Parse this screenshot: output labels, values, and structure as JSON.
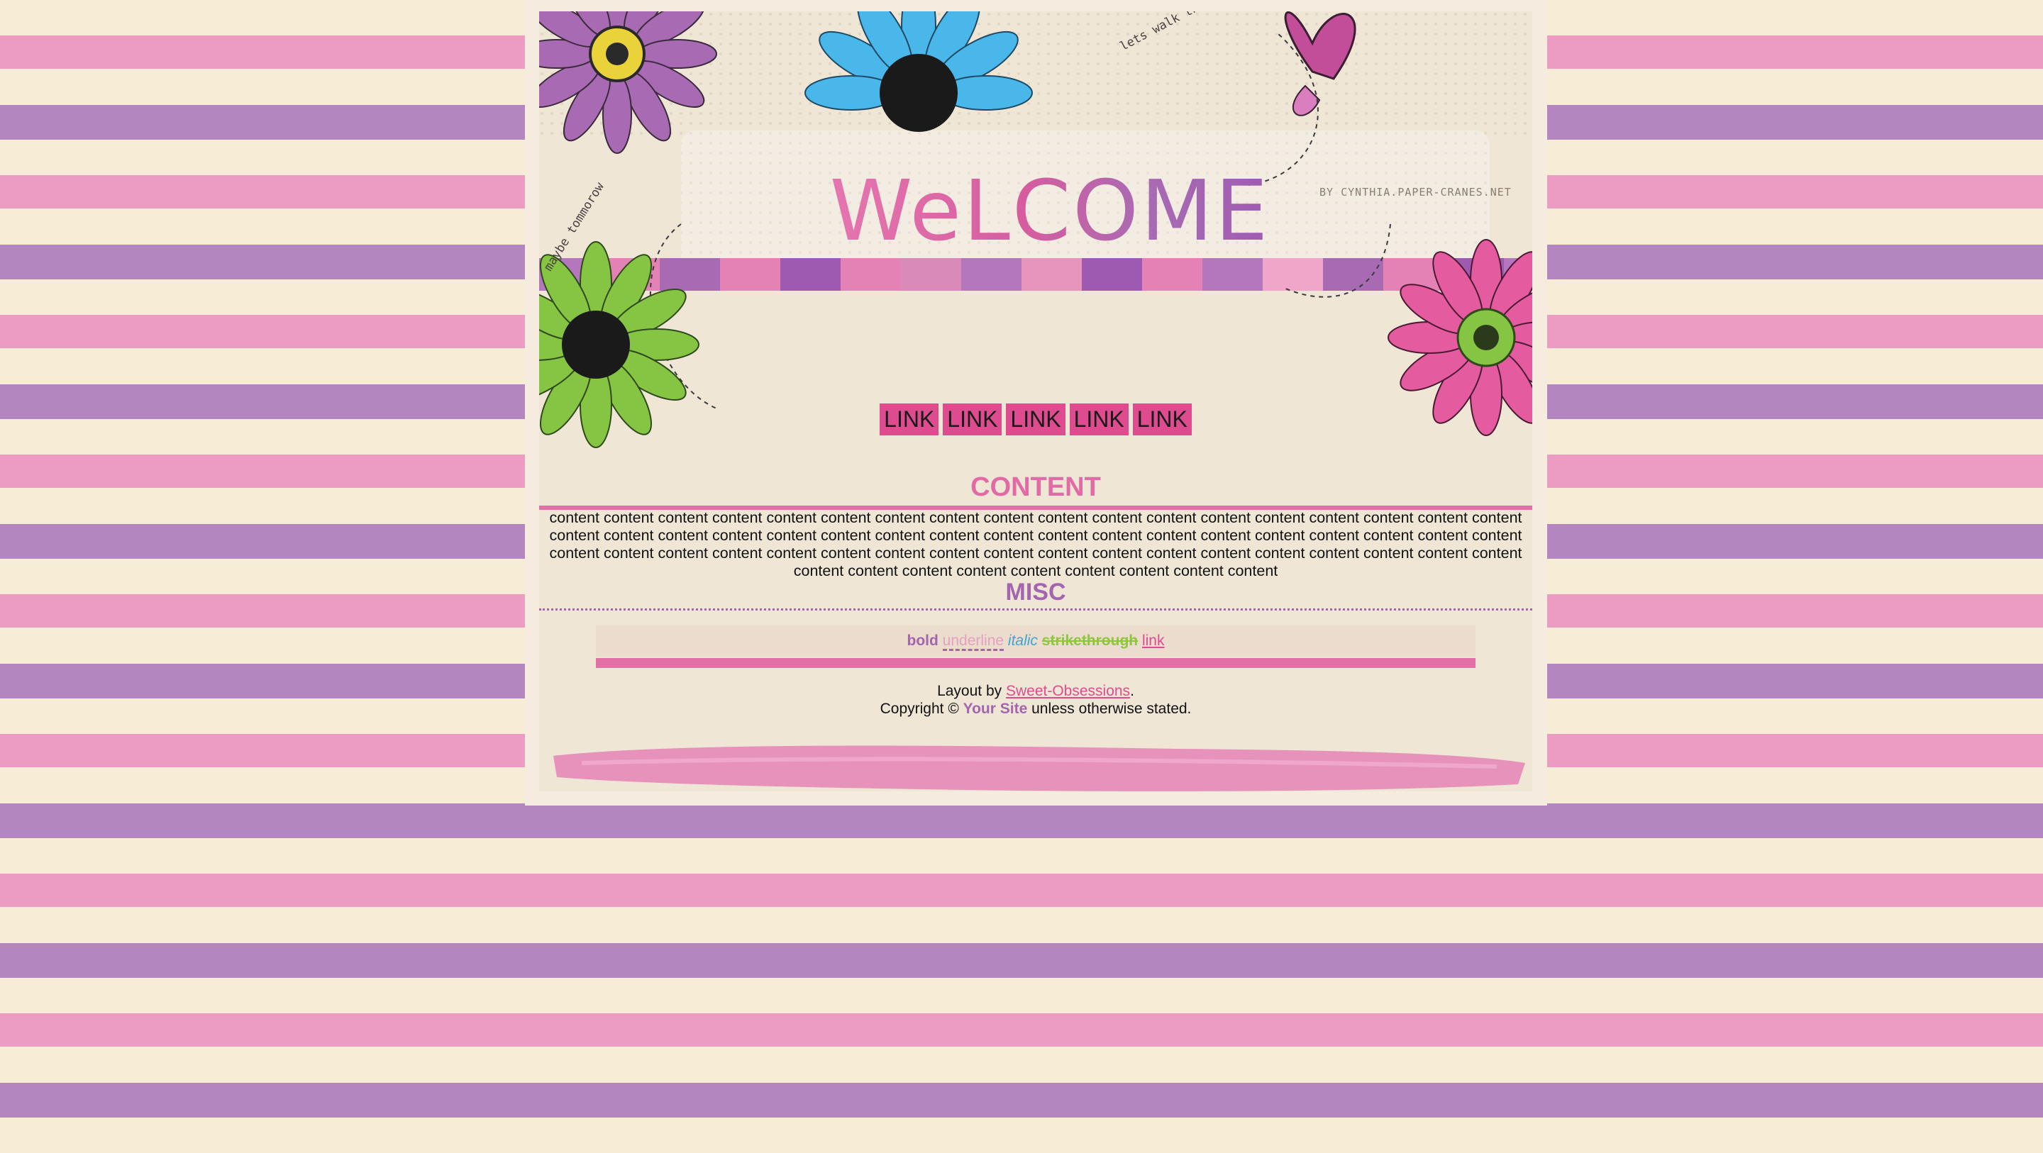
{
  "header": {
    "welcome": "WeLCOME",
    "credit": "BY CYNTHIA.PAPER-CRANES.NET",
    "tagline_top": "lets walk this way",
    "tagline_left": "maybe tommorow"
  },
  "nav": {
    "links": [
      "LINK",
      "LINK",
      "LINK",
      "LINK",
      "LINK"
    ]
  },
  "content": {
    "title": "CONTENT",
    "body": "content content content content content content content content content content content content content content content content content content content content content content content content content content content content content content content content content content content content content content content content content content content content content content content content content content content content content content content content content content content content content content content"
  },
  "misc": {
    "title": "MISC",
    "bold": "bold",
    "underline": "underline",
    "italic": "italic",
    "strikethrough": "strikethrough",
    "link": "link"
  },
  "footer": {
    "layout_prefix": "Layout by ",
    "layout_link": "Sweet-Obsessions",
    "layout_suffix": ".",
    "copyright_prefix": "Copyright © ",
    "site_name": "Your Site",
    "copyright_suffix": " unless otherwise stated."
  },
  "colors": {
    "pink": "#de4c8f",
    "purple": "#a365ad",
    "cream": "#f7ecd6",
    "accent_blue": "#3aa7d8",
    "accent_green": "#8ec63f"
  },
  "icons": [
    "purple-flower-icon",
    "blue-flower-icon",
    "green-flower-icon",
    "pink-flower-icon",
    "butterfly-icon"
  ]
}
